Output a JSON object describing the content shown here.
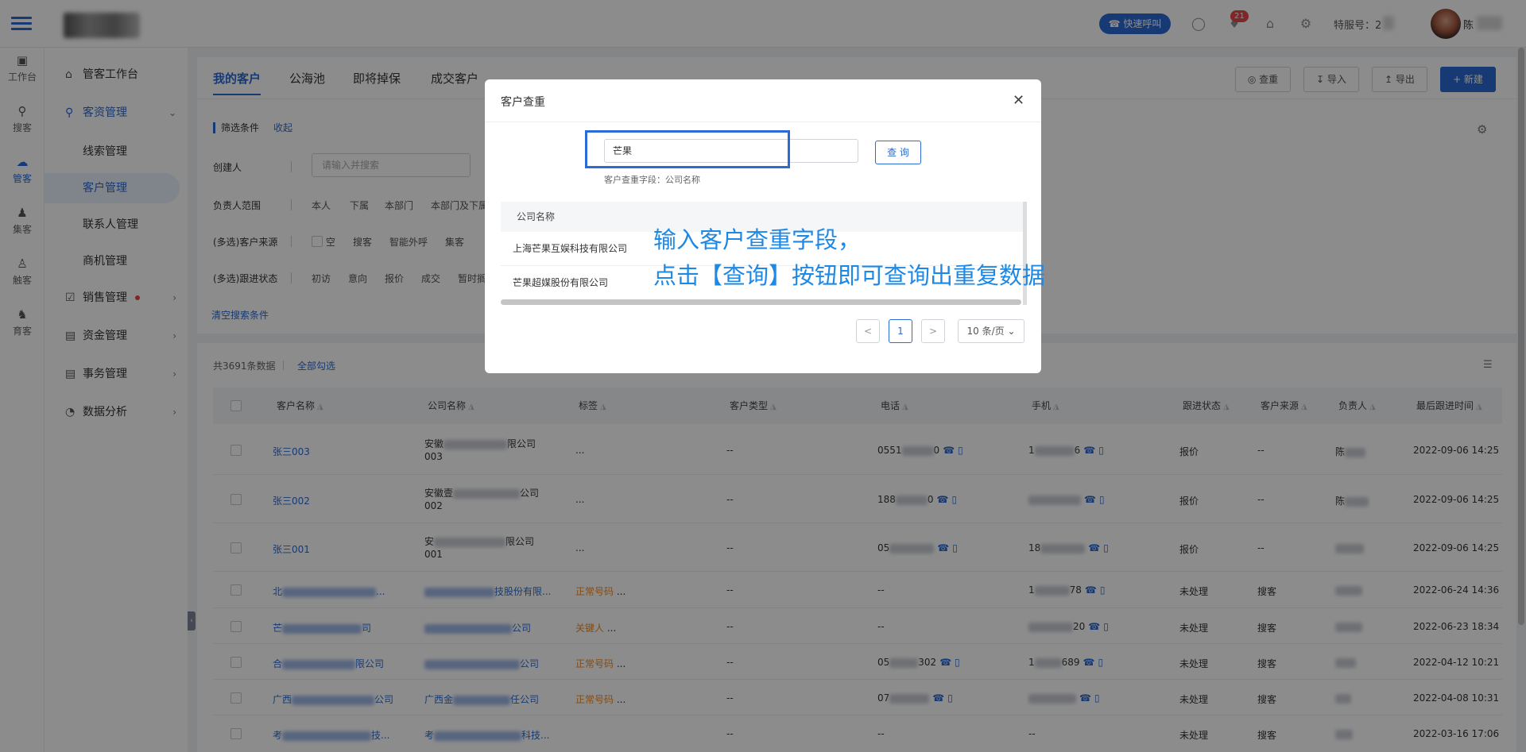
{
  "header": {
    "quick_call": "快速呼叫",
    "notification_count": "21",
    "service_no_label": "特服号：2",
    "username": "陈"
  },
  "rail": [
    {
      "label": "工作台",
      "icon": "monitor-icon"
    },
    {
      "label": "搜客",
      "icon": "search-user-icon"
    },
    {
      "label": "管客",
      "icon": "cloud-icon"
    },
    {
      "label": "集客",
      "icon": "group-icon"
    },
    {
      "label": "触客",
      "icon": "headset-icon"
    },
    {
      "label": "育客",
      "icon": "nurture-icon"
    }
  ],
  "nav": {
    "workbench": "管客工作台",
    "customer_mgmt": "客资管理",
    "sub": [
      "线索管理",
      "客户管理",
      "联系人管理",
      "商机管理"
    ],
    "sales": "销售管理",
    "funds": "资金管理",
    "affairs": "事务管理",
    "analytics": "数据分析"
  },
  "tabs": [
    "我的客户",
    "公海池",
    "即将掉保",
    "成交客户"
  ],
  "toolbar": {
    "dedupe": "查重",
    "import": "导入",
    "export": "导出",
    "new": "+ 新建"
  },
  "filters": {
    "title": "筛选条件",
    "collapse": "收起",
    "creator_label": "创建人",
    "creator_placeholder": "请输入并搜索",
    "owner_label": "负责人范围",
    "owner_opts": [
      "本人",
      "下属",
      "本部门",
      "本部门及下属"
    ],
    "source_label": "(多选)客户来源",
    "source_opts": [
      "空",
      "搜客",
      "智能外呼",
      "集客"
    ],
    "status_label": "(多选)跟进状态",
    "status_opts": [
      "初访",
      "意向",
      "报价",
      "成交",
      "暂时搁"
    ],
    "clear": "清空搜索条件"
  },
  "list": {
    "count": "共3691条数据",
    "select_all": "全部勾选",
    "columns": [
      "客户名称",
      "公司名称",
      "标签",
      "客户类型",
      "电话",
      "手机",
      "跟进状态",
      "客户来源",
      "负责人",
      "最后跟进时间"
    ],
    "rows": [
      {
        "name": "张三003",
        "company": [
          "安徽",
          "限公司",
          "003"
        ],
        "tag": "...",
        "type": "--",
        "phone": "0551",
        "phone_tail": "0",
        "mobile": "1",
        "mobile_tail": "6",
        "status": "报价",
        "source": "--",
        "owner": "陈",
        "time": "2022-09-06 14:25"
      },
      {
        "name": "张三002",
        "company": [
          "安徽壹",
          "公司",
          "002"
        ],
        "tag": "...",
        "type": "--",
        "phone": "188",
        "phone_tail": "0",
        "mobile": "",
        "mobile_tail": "",
        "status": "报价",
        "source": "--",
        "owner": "陈",
        "time": "2022-09-06 14:25"
      },
      {
        "name": "张三001",
        "company": [
          "安",
          "限公司",
          "001"
        ],
        "tag": "...",
        "type": "--",
        "phone": "05",
        "phone_tail": "",
        "mobile": "18",
        "mobile_tail": "",
        "status": "报价",
        "source": "--",
        "owner": "",
        "time": "2022-09-06 14:25"
      },
      {
        "name": "北",
        "name_tail": "...",
        "company_single": "技股份有限...",
        "tag": "正常号码",
        "tag_more": "...",
        "type": "--",
        "phone": "--",
        "phone_tail": "",
        "mobile": "1",
        "mobile_tail": "78",
        "status": "未处理",
        "source": "搜客",
        "owner": "",
        "time": "2022-06-24 14:36"
      },
      {
        "name": "芒",
        "name_tail": "司",
        "company_single": "公司",
        "tag": "关键人",
        "tag_more": "...",
        "type": "--",
        "phone": "--",
        "phone_tail": "",
        "mobile": "",
        "mobile_tail": "20",
        "status": "未处理",
        "source": "搜客",
        "owner": "",
        "time": "2022-06-23 18:34"
      },
      {
        "name": "合",
        "name_tail": "限公司",
        "company_single": "公司",
        "tag": "正常号码",
        "tag_more": "...",
        "type": "--",
        "phone": "05",
        "phone_tail": "302",
        "mobile": "1",
        "mobile_tail": "689",
        "status": "未处理",
        "source": "搜客",
        "owner": "",
        "time": "2022-04-12 10:21"
      },
      {
        "name": "广西",
        "name_tail": "公司",
        "company_single": "广西金",
        "company_tail": "任公司",
        "tag": "正常号码",
        "tag_more": "...",
        "type": "--",
        "phone": "07",
        "phone_tail": "",
        "mobile": "",
        "mobile_tail": "",
        "status": "未处理",
        "source": "搜客",
        "owner": "",
        "time": "2022-04-08 10:31"
      },
      {
        "name": "考",
        "name_tail": "技...",
        "company_single": "考",
        "company_tail": "科技...",
        "tag": "",
        "tag_more": "",
        "type": "--",
        "phone": "--",
        "phone_tail": "",
        "mobile": "--",
        "mobile_tail": "",
        "status": "未处理",
        "source": "搜客",
        "owner": "",
        "time": "2022-03-16 17:06"
      }
    ]
  },
  "modal": {
    "title": "客户查重",
    "input_value": "芒果",
    "query": "查 询",
    "hint": "客户查重字段：公司名称",
    "column": "公司名称",
    "results": [
      "上海芒果互娱科技有限公司",
      "芒果超媒股份有限公司"
    ],
    "page": "1",
    "page_size": "10 条/页",
    "prev": "<",
    "next": ">"
  },
  "annotation": [
    "输入客户查重字段，",
    "点击【查询】按钮即可查询出重复数据"
  ],
  "colors": {
    "primary": "#2b6bd6",
    "annotation": "#1e88e5",
    "tag": "#f08a24"
  }
}
